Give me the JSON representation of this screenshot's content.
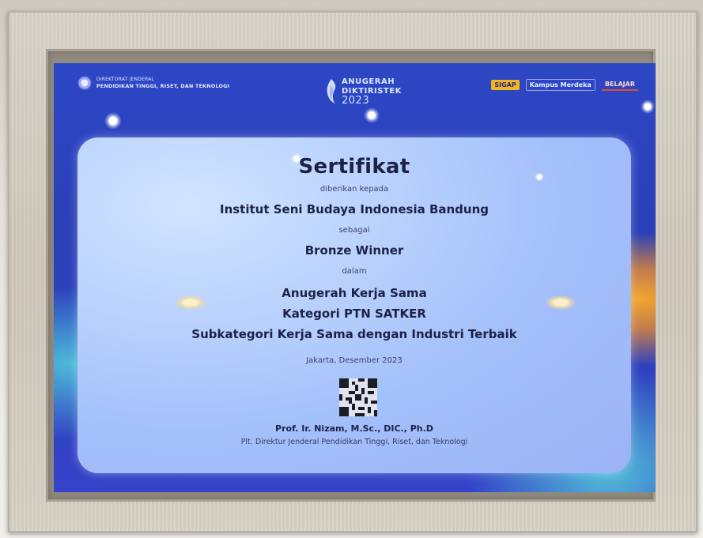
{
  "header": {
    "ministry_line1": "DIREKTORAT JENDERAL",
    "ministry_line2": "PENDIDIKAN TINGGI, RISET, DAN TEKNOLOGI",
    "event_line1": "ANUGERAH",
    "event_line2": "DIKTIRISTEK",
    "event_year": "2023",
    "partners": [
      "SIGAP",
      "Kampus Merdeka",
      "BELAJAR"
    ]
  },
  "certificate": {
    "title": "Sertifikat",
    "given_to_label": "diberikan kepada",
    "recipient": "Institut Seni Budaya Indonesia Bandung",
    "as_label": "sebagai",
    "award": "Bronze Winner",
    "in_label": "dalam",
    "program": "Anugerah Kerja Sama",
    "category": "Kategori PTN SATKER",
    "subcategory": "Subkategori Kerja Sama dengan Industri Terbaik",
    "place_date": "Jakarta, Desember 2023",
    "signer_name": "Prof. Ir. Nizam, M.Sc., DIC., Ph.D",
    "signer_title": "Plt. Direktur Jenderal Pendidikan Tinggi, Riset, dan Teknologi"
  },
  "colors": {
    "screen_blue": "#2d47c5",
    "card_light": "#b8ccfb",
    "text_dark": "#1d2147",
    "frame": "#d9d4ca",
    "accent_orange": "#ffaa28"
  }
}
